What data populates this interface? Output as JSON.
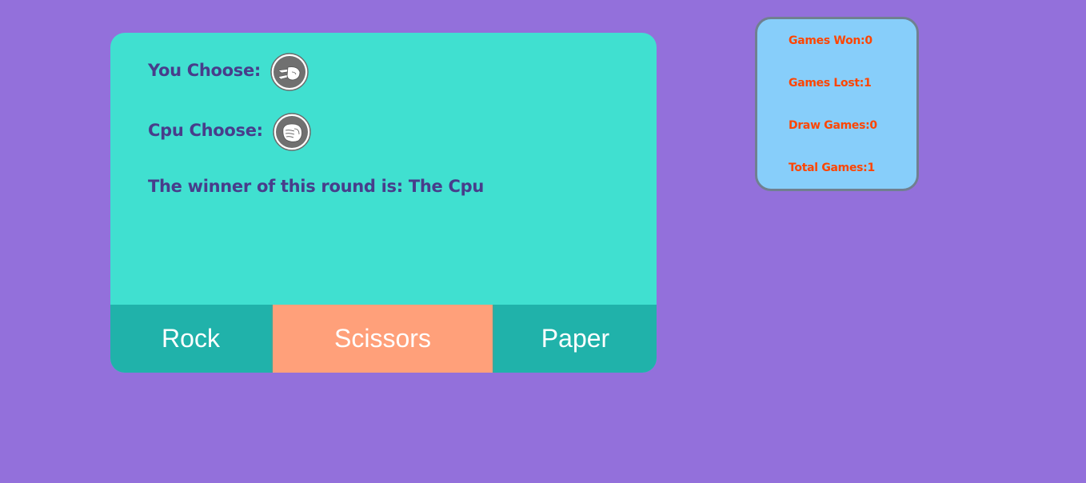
{
  "game": {
    "you_label": "You Choose:",
    "you_choice_icon": "scissors-hand-icon",
    "cpu_label": "Cpu Choose:",
    "cpu_choice_icon": "rock-fist-icon",
    "winner_text": "The winner of this round is: The Cpu"
  },
  "buttons": {
    "rock": "Rock",
    "scissors": "Scissors",
    "paper": "Paper"
  },
  "score": {
    "won": "Games Won:0",
    "lost": "Games Lost:1",
    "draw": "Draw Games:0",
    "total": "Total Games:1"
  },
  "colors": {
    "background": "#9370db",
    "card": "#40e0d0",
    "button": "#20b2aa",
    "button_active": "#ffa07a",
    "text": "#483d8b",
    "score_card": "#87cefa",
    "score_text": "#ff4500"
  }
}
